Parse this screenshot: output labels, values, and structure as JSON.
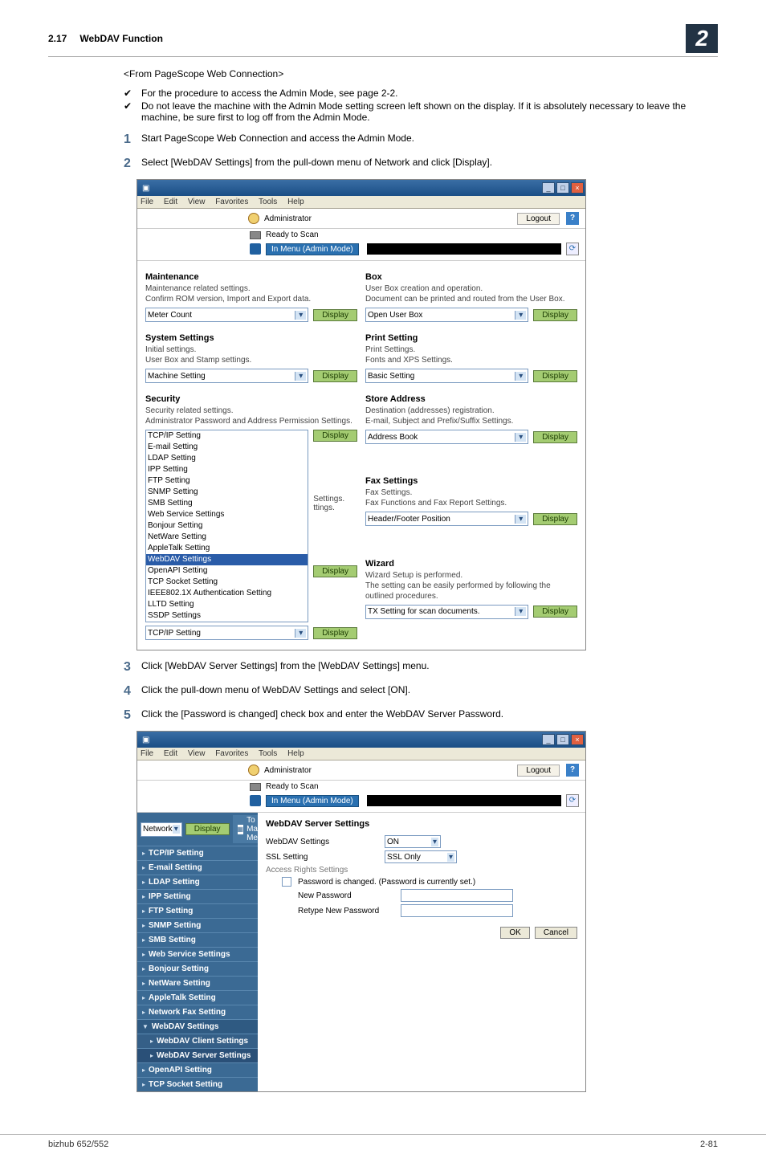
{
  "header": {
    "section_num": "2.17",
    "section_title": "WebDAV Function",
    "chapter_badge": "2"
  },
  "intro": "<From PageScope Web Connection>",
  "bullets": [
    "For the procedure to access the Admin Mode, see page 2-2.",
    "Do not leave the machine with the Admin Mode setting screen left shown on the display. If it is absolutely necessary to leave the machine, be sure first to log off from the Admin Mode."
  ],
  "steps_a": [
    "Start PageScope Web Connection and access the Admin Mode.",
    "Select [WebDAV Settings] from the pull-down menu of Network and click [Display]."
  ],
  "steps_b": [
    "Click [WebDAV Server Settings] from the [WebDAV Settings] menu.",
    "Click the pull-down menu of WebDAV Settings and select [ON].",
    "Click the [Password is changed] check box and enter the WebDAV Server Password."
  ],
  "menubar": {
    "file": "File",
    "edit": "Edit",
    "view": "View",
    "fav": "Favorites",
    "tools": "Tools",
    "help": "Help"
  },
  "common": {
    "administrator": "Administrator",
    "logout": "Logout",
    "help": "?",
    "ready": "Ready to Scan",
    "mode": "In Menu (Admin Mode)"
  },
  "shotA": {
    "maintenance": {
      "title": "Maintenance",
      "desc": "Maintenance related settings.\nConfirm ROM version, Import and Export data.",
      "select": "Meter Count",
      "btn": "Display"
    },
    "box": {
      "title": "Box",
      "desc": "User Box creation and operation.\nDocument can be printed and routed from the User Box.",
      "select": "Open User Box",
      "btn": "Display"
    },
    "system": {
      "title": "System Settings",
      "desc": "Initial settings.\nUser Box and Stamp settings.",
      "select": "Machine Setting",
      "btn": "Display"
    },
    "print": {
      "title": "Print Setting",
      "desc": "Print Settings.\nFonts and XPS Settings.",
      "select": "Basic Setting",
      "btn": "Display"
    },
    "security": {
      "title": "Security",
      "desc": "Security related settings.\nAdministrator Password and Address Permission Settings.",
      "btn": "Display",
      "list": [
        "TCP/IP Setting",
        "E-mail Setting",
        "LDAP Setting",
        "IPP Setting",
        "FTP Setting",
        "SNMP Setting",
        "SMB Setting",
        "Web Service Settings",
        "Bonjour Setting",
        "NetWare Setting",
        "AppleTalk Setting",
        "WebDAV Settings",
        "OpenAPI Setting",
        "TCP Socket Setting",
        "IEEE802.1X Authentication Setting",
        "LLTD Setting",
        "SSDP Settings"
      ],
      "highlighted": "WebDAV Settings",
      "frag1": "Settings.",
      "frag2": "ttings.",
      "bottom_select": "TCP/IP Setting"
    },
    "store": {
      "title": "Store Address",
      "desc": "Destination (addresses) registration.\nE-mail, Subject and Prefix/Suffix Settings.",
      "select": "Address Book",
      "btn": "Display"
    },
    "fax": {
      "title": "Fax Settings",
      "desc": "Fax Settings.\nFax Functions and Fax Report Settings.",
      "select": "Header/Footer Position",
      "btn": "Display"
    },
    "wizard": {
      "title": "Wizard",
      "desc": "Wizard Setup is performed.\nThe setting can be easily performed by following the outlined procedures.",
      "select": "TX Setting for scan documents.",
      "btn": "Display"
    }
  },
  "shotB": {
    "nav_select": "Network",
    "display": "Display",
    "to_main": "To Main Menu",
    "side": [
      "TCP/IP Setting",
      "E-mail Setting",
      "LDAP Setting",
      "IPP Setting",
      "FTP Setting",
      "SNMP Setting",
      "SMB Setting",
      "Web Service Settings",
      "Bonjour Setting",
      "NetWare Setting",
      "AppleTalk Setting",
      "Network Fax Setting"
    ],
    "side_group_head": "WebDAV Settings",
    "side_group": [
      "WebDAV Client Settings",
      "WebDAV Server Settings"
    ],
    "side_tail": [
      "OpenAPI Setting",
      "TCP Socket Setting"
    ],
    "main": {
      "title": "WebDAV Server Settings",
      "row1_label": "WebDAV Settings",
      "row1_val": "ON",
      "row2_label": "SSL Setting",
      "row2_val": "SSL Only",
      "access": "Access Rights Settings",
      "pwd_changed": "Password is changed. (Password is currently set.)",
      "new_pwd": "New Password",
      "retype_pwd": "Retype New Password",
      "ok": "OK",
      "cancel": "Cancel"
    }
  },
  "footer": {
    "left": "bizhub 652/552",
    "right": "2-81"
  }
}
